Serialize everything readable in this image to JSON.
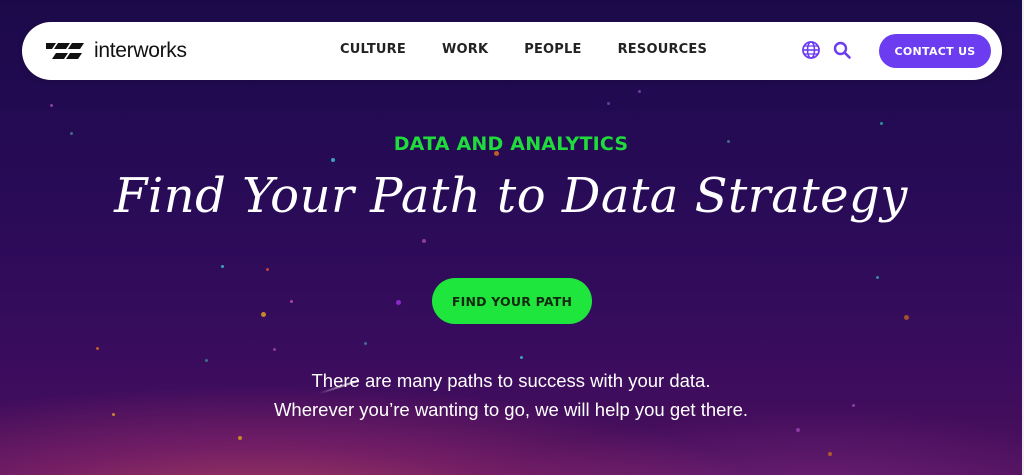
{
  "brand": {
    "name": "interworks"
  },
  "nav": {
    "items": [
      "CULTURE",
      "WORK",
      "PEOPLE",
      "RESOURCES"
    ],
    "globe_icon": "globe-icon",
    "search_icon": "search-icon",
    "contact_label": "CONTACT US"
  },
  "hero": {
    "eyebrow": "DATA AND ANALYTICS",
    "headline": "Find Your Path to Data Strategy",
    "cta_label": "FIND YOUR PATH",
    "sub_line1": "There are many paths to success with your data.",
    "sub_line2": "Wherever you’re wanting to go, we will help you get there."
  },
  "colors": {
    "accent_purple": "#6b3cf0",
    "accent_green": "#1ee63c",
    "hero_bg": "#2a0b58"
  }
}
